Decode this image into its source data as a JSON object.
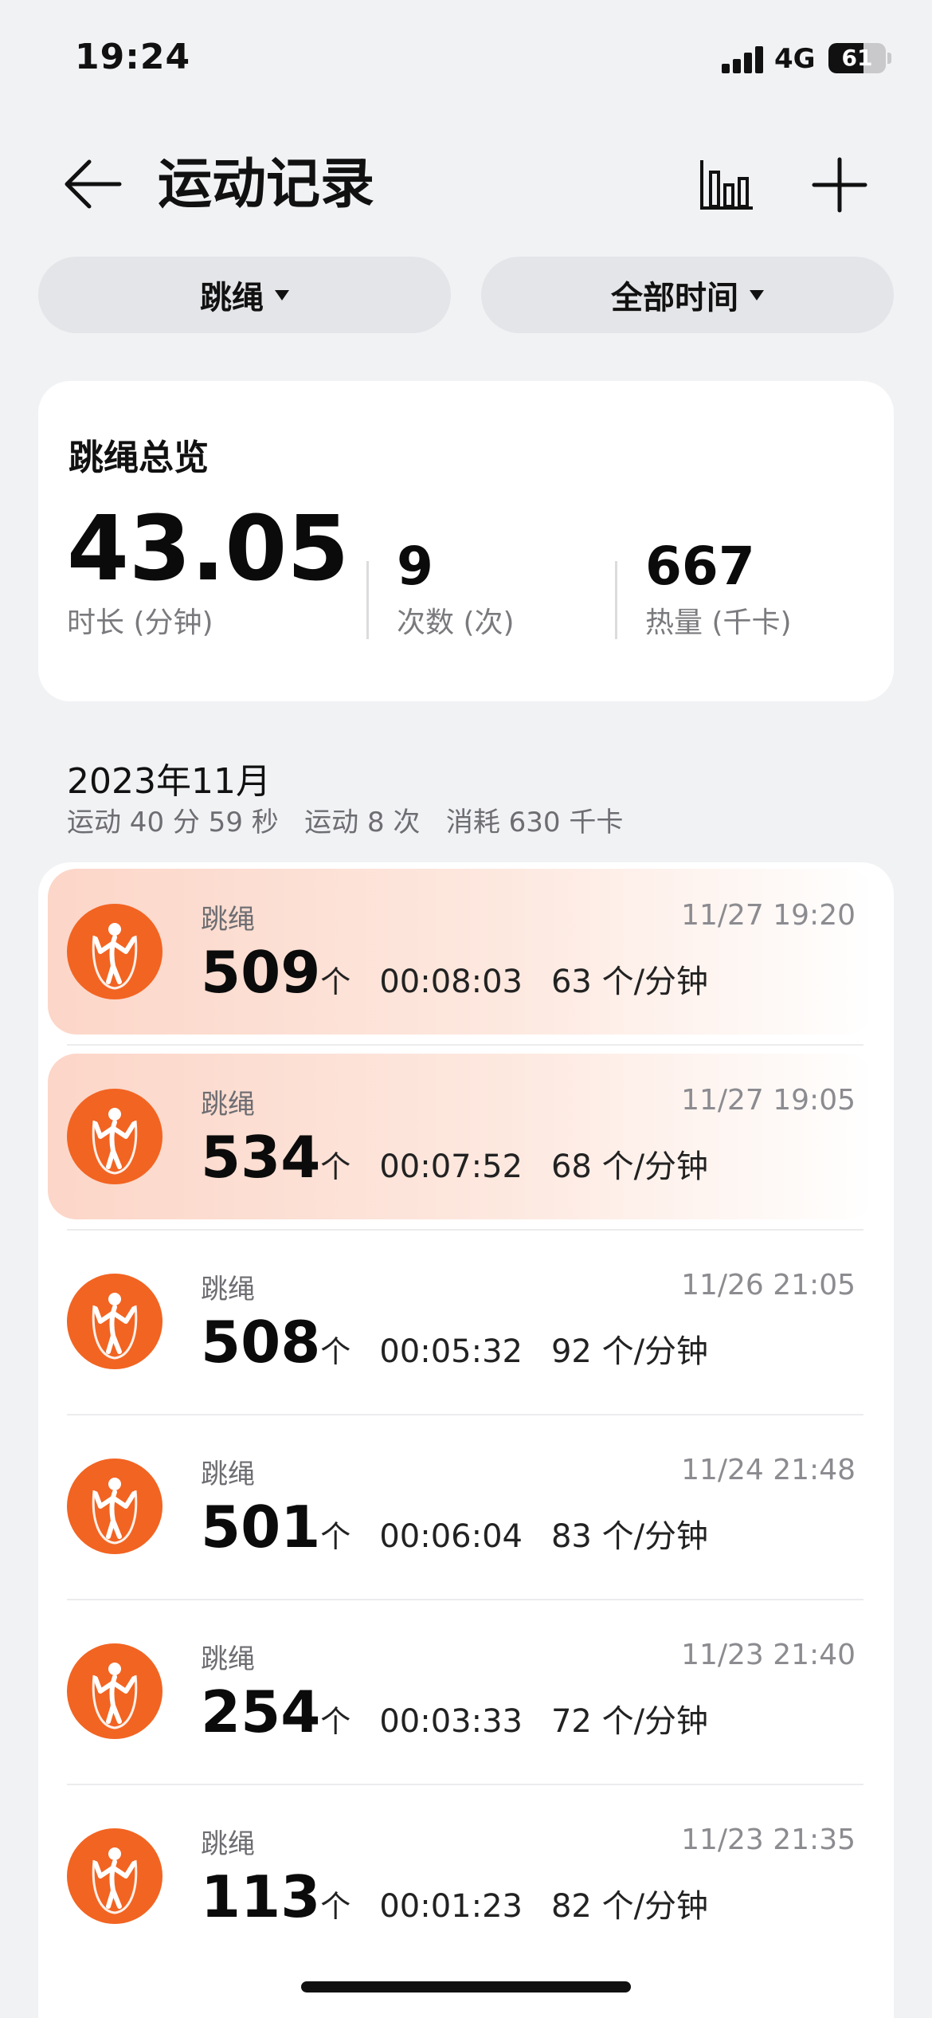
{
  "status_bar": {
    "time": "19:24",
    "network": "4G",
    "battery": "61",
    "battery_level": 0.61
  },
  "header": {
    "title": "运动记录",
    "back_icon": "arrow-left-icon",
    "chart_icon": "bar-chart-icon",
    "add_icon": "plus-icon"
  },
  "filters": {
    "sport": "跳绳",
    "time": "全部时间"
  },
  "summary": {
    "title": "跳绳总览",
    "duration_value": "43.05",
    "duration_label": "时长 (分钟)",
    "count_value": "9",
    "count_label": "次数 (次)",
    "calories_value": "667",
    "calories_label": "热量 (千卡)"
  },
  "month": {
    "title": "2023年11月",
    "summary": "运动 40 分 59 秒   运动 8 次   消耗 630 千卡"
  },
  "records": [
    {
      "type": "跳绳",
      "datetime": "11/27 19:20",
      "count": "509",
      "unit": "个",
      "duration": "00:08:03",
      "rate": "63 个/分钟",
      "highlighted": true
    },
    {
      "type": "跳绳",
      "datetime": "11/27 19:05",
      "count": "534",
      "unit": "个",
      "duration": "00:07:52",
      "rate": "68 个/分钟",
      "highlighted": true
    },
    {
      "type": "跳绳",
      "datetime": "11/26 21:05",
      "count": "508",
      "unit": "个",
      "duration": "00:05:32",
      "rate": "92 个/分钟",
      "highlighted": false
    },
    {
      "type": "跳绳",
      "datetime": "11/24 21:48",
      "count": "501",
      "unit": "个",
      "duration": "00:06:04",
      "rate": "83 个/分钟",
      "highlighted": false
    },
    {
      "type": "跳绳",
      "datetime": "11/23 21:40",
      "count": "254",
      "unit": "个",
      "duration": "00:03:33",
      "rate": "72 个/分钟",
      "highlighted": false
    },
    {
      "type": "跳绳",
      "datetime": "11/23 21:35",
      "count": "113",
      "unit": "个",
      "duration": "00:01:23",
      "rate": "82 个/分钟",
      "highlighted": false
    }
  ],
  "colors": {
    "accent": "#f26422",
    "highlight": "#fcd6c8",
    "background": "#f1f2f4"
  },
  "record_icon": "jump-rope-icon"
}
